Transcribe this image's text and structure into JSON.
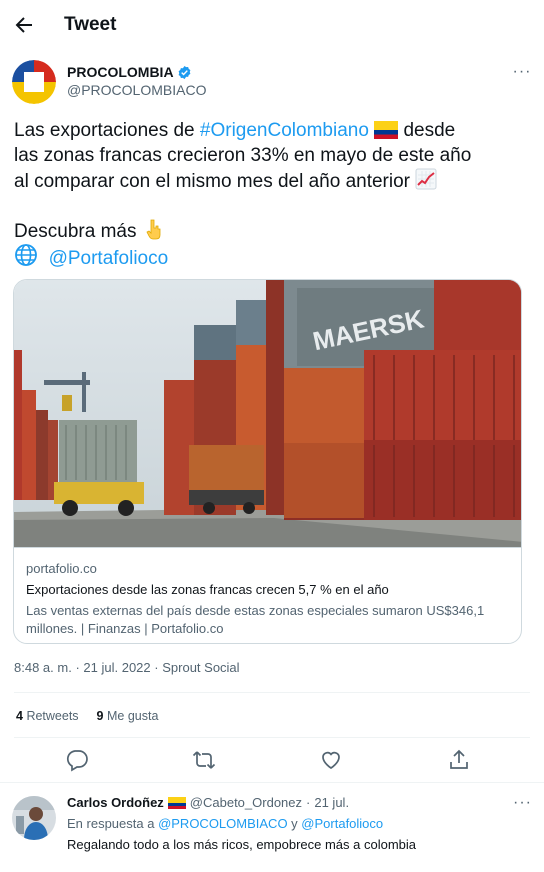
{
  "header": {
    "title": "Tweet",
    "back_icon": "arrow-left-icon"
  },
  "author": {
    "name": "PROCOLOMBIA",
    "handle": "@PROCOLOMBIACO",
    "verified": true,
    "more": "···"
  },
  "tweet": {
    "line1_a": "Las exportaciones de ",
    "line1_hashtag": "#OrigenColombiano",
    "line1_b": " desde",
    "line2": "las zonas francas crecieron 33% en mayo de este año",
    "line3": "al comparar con el mismo mes del año anterior",
    "line5": "Descubra más",
    "mention": "@Portafolioco"
  },
  "card": {
    "domain": "portafolio.co",
    "title": "Exportaciones desde las zonas francas crecen 5,7 % en el año",
    "description": "Las ventas externas del país desde estas zonas especiales sumaron US$346,1 millones. | Finanzas | Portafolio.co",
    "image_alt": "container-port-photo",
    "container_text": "MAERSK"
  },
  "meta": {
    "time": "8:48 a. m.",
    "sep": "·",
    "date": "21 jul. 2022",
    "source": "Sprout Social"
  },
  "stats": {
    "retweets_count": "4",
    "retweets_label": "Retweets",
    "likes_count": "9",
    "likes_label": "Me gusta"
  },
  "actions": [
    "reply-icon",
    "retweet-icon",
    "like-icon",
    "share-icon"
  ],
  "reply": {
    "name": "Carlos Ordoñez",
    "handle": "@Cabeto_Ordonez",
    "sep": "·",
    "date": "21 jul.",
    "in_reply_prefix": "En respuesta a ",
    "reply_to_1": "@PROCOLOMBIACO",
    "reply_and": " y ",
    "reply_to_2": "@Portafolioco",
    "text": "Regalando todo a los más ricos, empobrece más a colombia",
    "more": "···"
  },
  "colors": {
    "link": "#1d9bf0",
    "muted": "#536471",
    "text": "#0f1419",
    "border": "#cfd9de"
  }
}
